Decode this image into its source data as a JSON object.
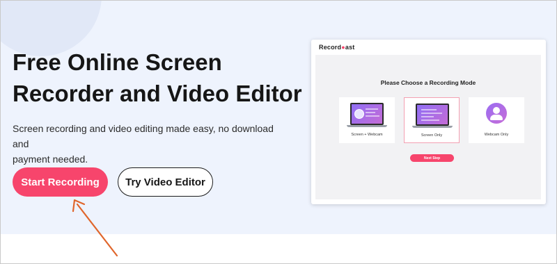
{
  "hero": {
    "headline_line1": "Free Online Screen",
    "headline_line2": "Recorder and Video Editor",
    "description_line1": "Screen recording and video editing made easy, no download and",
    "description_line2": "payment needed.",
    "primary_button": "Start Recording",
    "secondary_button": "Try Video Editor"
  },
  "preview": {
    "logo_part1": "Record",
    "logo_part2": "ast",
    "logo_mark_icon": "record-c-icon",
    "title": "Please Choose a Recording Mode",
    "modes": [
      {
        "label": "Screen + Webcam",
        "icon": "laptop-webcam-icon",
        "selected": false
      },
      {
        "label": "Screen Only",
        "icon": "laptop-icon",
        "selected": true
      },
      {
        "label": "Webcam Only",
        "icon": "person-icon",
        "selected": false
      }
    ],
    "next_button": "Next Step"
  },
  "colors": {
    "accent": "#f7456c",
    "hero_background": "#eef3fd",
    "annotation_arrow": "#e0662c"
  }
}
